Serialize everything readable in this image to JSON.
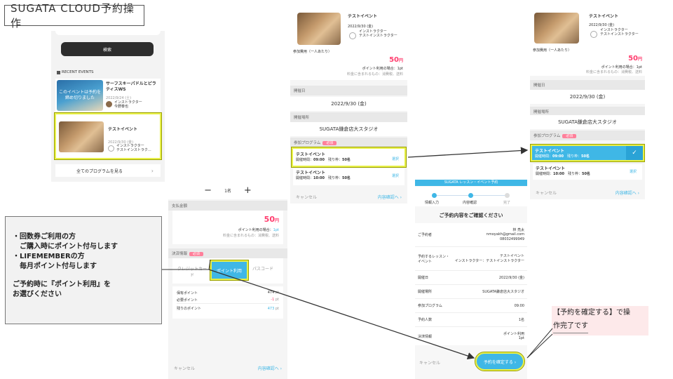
{
  "title": "SUGATA  CLOUD予約操作",
  "screen1": {
    "search_label": "検索",
    "recent_label": "RECENT EVENTS",
    "event1": {
      "name": "サーフスキーパドルとピラティスWS",
      "date": "2022/9/24 (土)",
      "instructor": "インストラクター\n今野泰也",
      "overlay": "このイベントは予約を締め切りました"
    },
    "event2": {
      "name": "テストイベント",
      "date": "2022/9/30 (金)",
      "instructor": "インストラクター\nテストインストラク..."
    },
    "all_programs": "全てのプログラムを見る",
    "chevron": "›"
  },
  "screen2": {
    "qty_minus": "−",
    "qty_value": "1名",
    "qty_plus": "+",
    "payment_section": "支払金額",
    "price": "50",
    "price_unit": "円",
    "points_note_label": "ポイント利用の場合：",
    "points_note_value": "1pt",
    "tax_note": "料金に含まれるもの：消費税、送料",
    "method_section": "決済情報",
    "required": "必須",
    "method_tabs": [
      "クレジットカード",
      "ポイント利用",
      "パスコード"
    ],
    "held_points_label": "保有ポイント",
    "held_points_value": "474",
    "needed_points_label": "必要ポイント",
    "needed_points_value": "-1",
    "remaining_points_label": "残りのポイント",
    "remaining_points_value": "473",
    "pt_unit": "pt",
    "cancel": "キャンセル",
    "next": "内容確認へ ›"
  },
  "screen3": {
    "event_name": "テストイベント",
    "event_date": "2022/9/30 (金)",
    "instructor": "インストラクター\nテストインストラクター",
    "fee_label": "参加費用（一人あたり）",
    "price": "50",
    "price_unit": "円",
    "points_note": "ポイント利用の場合：1pt",
    "tax_note": "料金に含まれるもの：消費税、送料",
    "date_section": "開催日",
    "date_value": "2022/9/30 (金)",
    "place_section": "開催場所",
    "place_value": "SUGATA鎌倉店大スタジオ",
    "program_section": "参加プログラム",
    "required": "必須",
    "programs": [
      {
        "name": "テストイベント",
        "time_label": "開催時間：",
        "time": "09:00",
        "left_label": "残り枠：",
        "left": "50名",
        "action": "選択"
      },
      {
        "name": "テストイベント",
        "time_label": "開催時間：",
        "time": "10:00",
        "left_label": "残り枠：",
        "left": "50名",
        "action": "選択"
      }
    ],
    "cancel": "キャンセル",
    "next": "内容確認へ ›"
  },
  "screen4": {
    "header": "SUGATA レッスン・イベント予約",
    "steps": [
      "情報入力",
      "内容確認",
      "完了"
    ],
    "heading": "ご予約内容をご確認ください",
    "rows": [
      {
        "label": "ご予約者",
        "value": "林 亮太\nnmoyakh@gmail.com\n08032499949"
      },
      {
        "label": "予約するレッスン・イベント",
        "value": "テストイベント\nインストラクター：テストインストラクター"
      },
      {
        "label": "開催日",
        "value": "2022/9/30 (金)"
      },
      {
        "label": "開催場所",
        "value": "SUGATA鎌倉店大スタジオ"
      },
      {
        "label": "参加プログラム",
        "value": "09:00"
      },
      {
        "label": "予約人数",
        "value": "1名"
      },
      {
        "label": "決済情報",
        "value": "ポイント利用\n1pt"
      }
    ],
    "cancel": "キャンセル",
    "confirm": "予約を確定する ›"
  },
  "screen5": {
    "event_name": "テストイベント",
    "event_date": "2022/9/30 (金)",
    "instructor": "インストラクター\nテストインストラクター",
    "fee_label": "参加費用（一人あたり）",
    "price": "50",
    "price_unit": "円",
    "points_note": "ポイント利用の場合：1pt",
    "tax_note": "料金に含まれるもの：消費税、送料",
    "date_section": "開催日",
    "date_value": "2022/9/30 (金)",
    "place_section": "開催場所",
    "place_value": "SUGATA鎌倉店大スタジオ",
    "program_section": "参加プログラム",
    "required": "必須",
    "programs": [
      {
        "name": "テストイベント",
        "time_label": "開催時間：",
        "time": "09:00",
        "left_label": "残り枠：",
        "left": "50名",
        "action": "✓"
      },
      {
        "name": "テストイベント",
        "time_label": "開催時間：",
        "time": "10:00",
        "left_label": "残り枠：",
        "left": "50名",
        "action": "選択"
      }
    ],
    "cancel": "キャンセル",
    "next": "内容確認へ ›"
  },
  "left_note": {
    "line1": "・回数券ご利用の方",
    "line2": "　ご購入時にポイント付与します",
    "line3": "・LIFEMEMBERの方",
    "line4": "　毎月ポイント付与します",
    "line5": "ご予約時に『ポイント利用』を",
    "line6": "お選びください"
  },
  "right_note": {
    "line1": "【予約を確定する】で操",
    "line2": "作完了です"
  }
}
